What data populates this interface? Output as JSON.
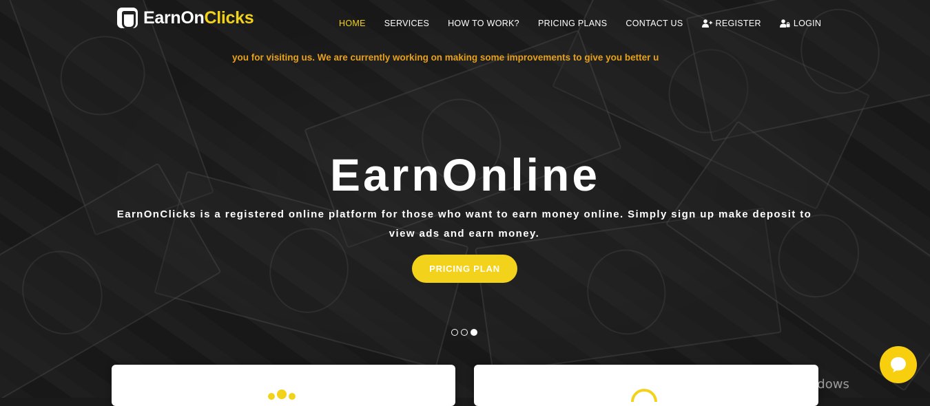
{
  "brand": {
    "name_part1": "EarnOn",
    "name_part2": "Clicks",
    "accent_color": "#f2d21b"
  },
  "nav": {
    "items": [
      {
        "label": "HOME",
        "active": true
      },
      {
        "label": "SERVICES"
      },
      {
        "label": "HOW TO WORK?"
      },
      {
        "label": "PRICING PLANS"
      },
      {
        "label": "CONTACT US"
      }
    ],
    "register_label": "REGISTER",
    "login_label": "LOGIN",
    "register_icon": "user-plus-icon",
    "login_icon": "user-lock-icon"
  },
  "announcement": "you for visiting us. We are currently working on making some improvements to give you better u",
  "hero": {
    "title": "EarnOnline",
    "description": "EarnOnClicks is a registered online platform for those who want to earn money online. Simply sign up make deposit to view ads and earn money.",
    "cta_label": "PRICING PLAN",
    "slides_count": 3,
    "active_slide": 3
  },
  "watermark": "Activate Windows",
  "chat_icon": "chat-bubble-icon"
}
